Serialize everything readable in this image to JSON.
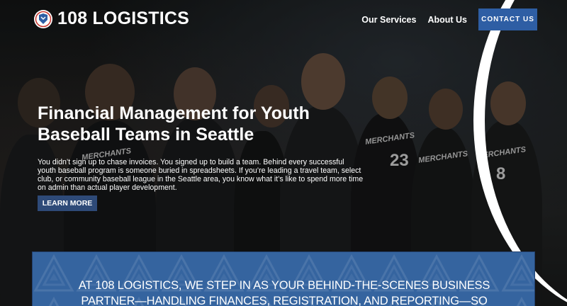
{
  "brand": {
    "name": "108 LOGISTICS",
    "logo_icon": "baseball-shield-icon"
  },
  "nav": {
    "links": [
      "Our Services",
      "About Us"
    ],
    "cta": "CONTACT US"
  },
  "hero": {
    "headline_line1": "Financial Management for Youth",
    "headline_line2": "Baseball Teams in Seattle",
    "body": "You didn’t sign up to chase invoices. You signed up to build a team. Behind every successful youth baseball program is someone buried in spreadsheets. If you’re leading a travel team, select club, or community baseball league in the Seattle area, you know what it’s like to spend more time on admin than actual player development.",
    "button": "LEARN MORE",
    "jersey_text": [
      "MERCHANTS",
      "MERCHANTS",
      "MERCHANTS",
      "MERCHANTS"
    ],
    "jersey_numbers": [
      "23",
      "8"
    ]
  },
  "banner": {
    "line1": "AT 108 LOGISTICS, WE STEP IN AS YOUR BEHIND-THE-SCENES BUSINESS",
    "line2": "PARTNER—HANDLING FINANCES, REGISTRATION, AND REPORTING—SO"
  },
  "colors": {
    "accent": "#2e5ea4",
    "button": "#2e4a78",
    "banner": "#35649f",
    "text": "#ffffff"
  }
}
